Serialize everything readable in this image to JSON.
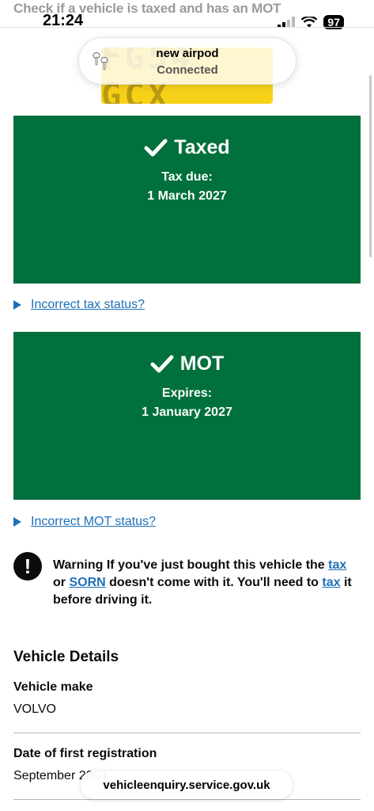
{
  "page": {
    "title": "Check if a vehicle is taxed and has an MOT"
  },
  "status_bar": {
    "time": "21:24",
    "battery": "97"
  },
  "vehicle": {
    "registration_plate": "FG54 GCX"
  },
  "airpod_notification": {
    "name": "new airpod",
    "status": "Connected"
  },
  "tax": {
    "heading": "Taxed",
    "label": "Tax due:",
    "date": "1 March 2027",
    "incorrect_link": "Incorrect tax status?"
  },
  "mot": {
    "heading": "MOT",
    "label": "Expires:",
    "date": "1 January 2027",
    "incorrect_link": "Incorrect MOT status?"
  },
  "warning": {
    "icon": "!",
    "prefix": "Warning",
    "text_1": "If you've just bought this vehicle the",
    "link_tax_1": "tax",
    "text_2": "or",
    "link_sorn": "SORN",
    "text_3": "doesn't come with it. You'll need to",
    "link_tax_2": "tax",
    "text_4": "it before driving it."
  },
  "vehicle_details": {
    "title": "Vehicle Details",
    "rows": [
      {
        "key": "Vehicle make",
        "value": "VOLVO"
      },
      {
        "key": "Date of first registration",
        "value": "September 2004"
      }
    ]
  },
  "browser": {
    "url": "vehicleenquiry.service.gov.uk"
  },
  "colors": {
    "panel_green": "#00703c",
    "link_blue": "#1d70b8",
    "plate_yellow": "#f7d117"
  }
}
